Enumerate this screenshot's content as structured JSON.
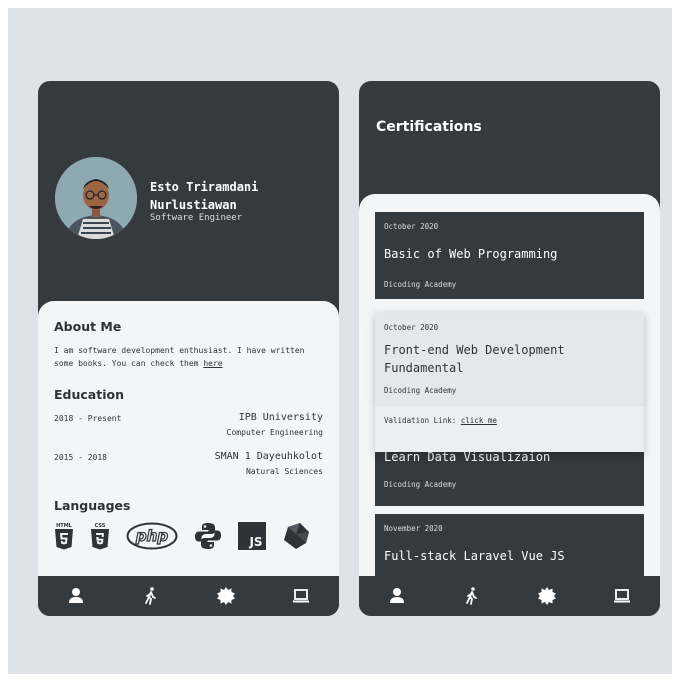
{
  "profile": {
    "name": "Esto Triramdani Nurlustiawan",
    "role": "Software Engineer"
  },
  "about": {
    "heading": "About Me",
    "text": "I am software development enthusiast. I have written some books. You can check them ",
    "link_label": "here"
  },
  "education": {
    "heading": "Education",
    "entries": [
      {
        "period": "2018 - Present",
        "school": "IPB University",
        "major": "Computer Engineering"
      },
      {
        "period": "2015 - 2018",
        "school": "SMAN 1 Dayeuhkolot",
        "major": "Natural Sciences"
      }
    ]
  },
  "languages": {
    "heading": "Languages",
    "items": [
      "html5-icon",
      "css3-icon",
      "php-icon",
      "python-icon",
      "javascript-icon",
      "dart-icon"
    ],
    "html_label": "HTML",
    "css_label": "CSS",
    "php_label": "php",
    "js_label": "JS"
  },
  "nav": {
    "items": [
      "user-icon",
      "walking-icon",
      "gear-icon",
      "laptop-icon"
    ]
  },
  "certifications": {
    "heading": "Certifications",
    "cards": [
      {
        "date": "October 2020",
        "title": "Basic of Web Programming",
        "issuer": "Dicoding Academy"
      },
      {
        "date": "October 2020",
        "title": "Front-end Web Development Fundamental",
        "issuer": "Dicoding Academy",
        "validation_label": "Validation Link:",
        "validation_link": "click me"
      },
      {
        "title": "Learn Data Visualizaion",
        "issuer": "Dicoding Academy"
      },
      {
        "date": "November 2020",
        "title": "Full-stack Laravel Vue JS"
      }
    ]
  },
  "colors": {
    "dark": "#353a3f",
    "light": "#f3f5f7",
    "background": "#dfe3e8"
  }
}
